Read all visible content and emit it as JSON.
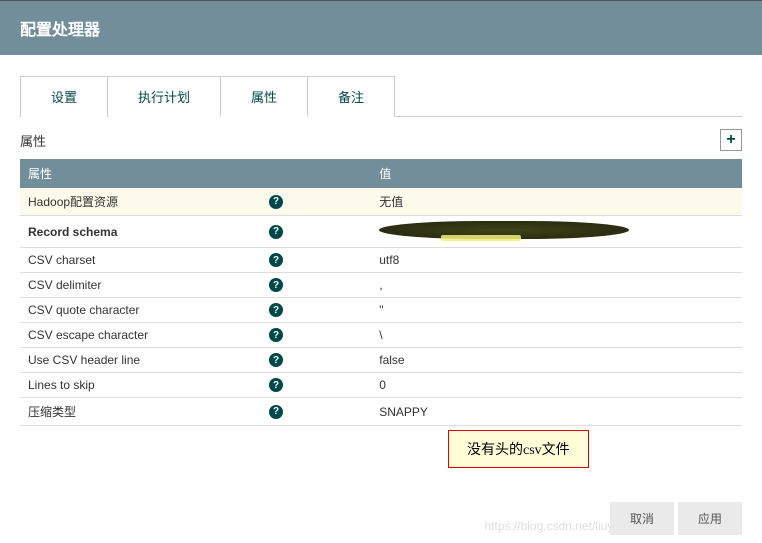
{
  "header": {
    "title": "配置处理器"
  },
  "tabs": [
    {
      "label": "设置",
      "active": false
    },
    {
      "label": "执行计划",
      "active": false
    },
    {
      "label": "属性",
      "active": true
    },
    {
      "label": "备注",
      "active": false
    }
  ],
  "section": {
    "title": "属性"
  },
  "table": {
    "headers": {
      "name": "属性",
      "value": "值"
    },
    "rows": [
      {
        "name": "Hadoop配置资源",
        "value": "无值",
        "bold": false,
        "novalue": true,
        "redacted": false,
        "highlight": true
      },
      {
        "name": "Record schema",
        "value": "",
        "bold": true,
        "novalue": false,
        "redacted": true,
        "highlight": false
      },
      {
        "name": "CSV charset",
        "value": "utf8",
        "bold": false,
        "novalue": false,
        "redacted": false,
        "highlight": false
      },
      {
        "name": "CSV delimiter",
        "value": ",",
        "bold": false,
        "novalue": false,
        "redacted": false,
        "highlight": false
      },
      {
        "name": "CSV quote character",
        "value": "\"",
        "bold": false,
        "novalue": false,
        "redacted": false,
        "highlight": false
      },
      {
        "name": "CSV escape character",
        "value": "\\",
        "bold": false,
        "novalue": false,
        "redacted": false,
        "highlight": false
      },
      {
        "name": "Use CSV header line",
        "value": "false",
        "bold": false,
        "novalue": false,
        "redacted": false,
        "highlight": false
      },
      {
        "name": "Lines to skip",
        "value": "0",
        "bold": false,
        "novalue": false,
        "redacted": false,
        "highlight": false
      },
      {
        "name": "压缩类型",
        "value": "SNAPPY",
        "bold": false,
        "novalue": false,
        "redacted": false,
        "highlight": false
      }
    ]
  },
  "callout": {
    "text": "没有头的csv文件"
  },
  "footer": {
    "cancel": "取消",
    "apply": "应用"
  },
  "watermark": "https://blog.csdn.net/liuyunshengsir",
  "icons": {
    "add": "+",
    "help": "?"
  }
}
